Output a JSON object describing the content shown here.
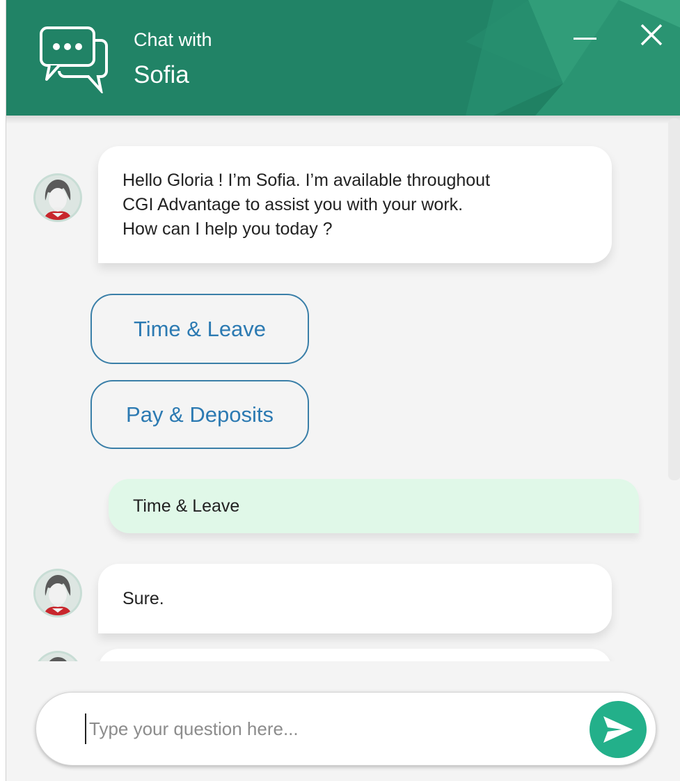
{
  "header": {
    "title_small": "Chat with",
    "title_name": "Sofia"
  },
  "messages": [
    {
      "type": "bot",
      "text_lines": [
        "Hello Gloria ! I’m Sofia. I’m available throughout",
        "CGI Advantage to assist you with your work.",
        "How can I help you today ?"
      ]
    },
    {
      "type": "options",
      "options": [
        "Time & Leave",
        "Pay & Deposits"
      ]
    },
    {
      "type": "user",
      "text": "Time & Leave"
    },
    {
      "type": "bot",
      "text": "Sure."
    }
  ],
  "composer": {
    "placeholder": "Type your question here..."
  },
  "colors": {
    "header": "#218366",
    "send_button": "#23b08a",
    "option_text": "#2c7ab2",
    "user_bubble": "#e0f8e8"
  },
  "icons": {
    "header": "chat-bubbles-icon",
    "minimize": "minimize-icon",
    "close": "close-icon",
    "send": "send-icon"
  }
}
